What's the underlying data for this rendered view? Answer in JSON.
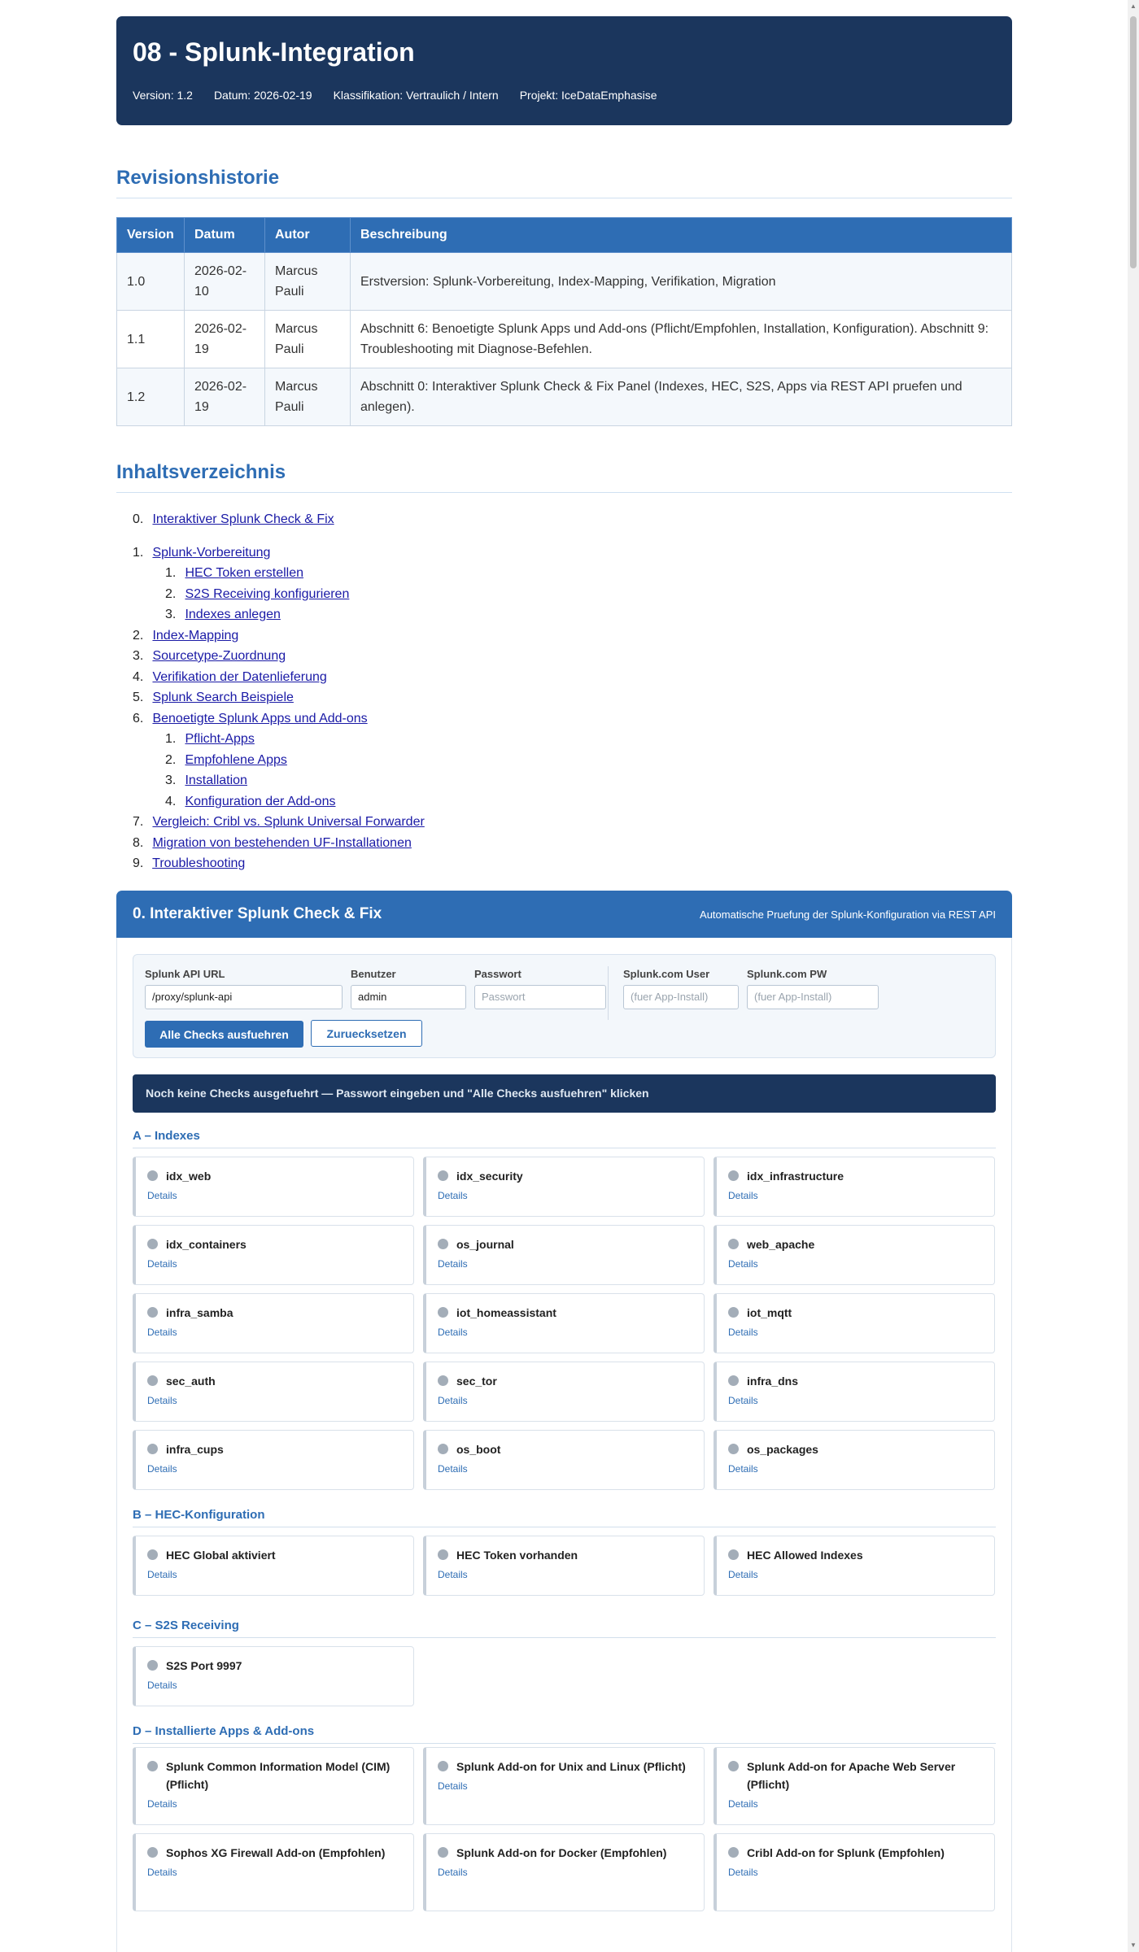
{
  "header": {
    "title": "08 - Splunk-Integration",
    "version": "Version: 1.2",
    "date": "Datum: 2026-02-19",
    "classification": "Klassifikation: Vertraulich / Intern",
    "project": "Projekt: IceDataEmphasise"
  },
  "revision": {
    "title": "Revisionshistorie",
    "columns": [
      "Version",
      "Datum",
      "Autor",
      "Beschreibung"
    ],
    "rows": [
      [
        "1.0",
        "2026-02-10",
        "Marcus Pauli",
        "Erstversion: Splunk-Vorbereitung, Index-Mapping, Verifikation, Migration"
      ],
      [
        "1.1",
        "2026-02-19",
        "Marcus Pauli",
        "Abschnitt 6: Benoetigte Splunk Apps und Add-ons (Pflicht/Empfohlen, Installation, Konfiguration). Abschnitt 9: Troubleshooting mit Diagnose-Befehlen."
      ],
      [
        "1.2",
        "2026-02-19",
        "Marcus Pauli",
        "Abschnitt 0: Interaktiver Splunk Check & Fix Panel (Indexes, HEC, S2S, Apps via REST API pruefen und anlegen)."
      ]
    ]
  },
  "toc": {
    "title": "Inhaltsverzeichnis",
    "items": [
      {
        "num": "0.",
        "label": "Interaktiver Splunk Check & Fix"
      },
      {
        "num": "1.",
        "label": "Splunk-Vorbereitung",
        "sub": [
          "HEC Token erstellen",
          "S2S Receiving konfigurieren",
          "Indexes anlegen"
        ]
      },
      {
        "num": "2.",
        "label": "Index-Mapping"
      },
      {
        "num": "3.",
        "label": "Sourcetype-Zuordnung"
      },
      {
        "num": "4.",
        "label": "Verifikation der Datenlieferung"
      },
      {
        "num": "5.",
        "label": "Splunk Search Beispiele"
      },
      {
        "num": "6.",
        "label": "Benoetigte Splunk Apps und Add-ons",
        "sub": [
          "Pflicht-Apps",
          "Empfohlene Apps",
          "Installation",
          "Konfiguration der Add-ons"
        ]
      },
      {
        "num": "7.",
        "label": "Vergleich: Cribl vs. Splunk Universal Forwarder"
      },
      {
        "num": "8.",
        "label": "Migration von bestehenden UF-Installationen"
      },
      {
        "num": "9.",
        "label": "Troubleshooting"
      }
    ]
  },
  "panel": {
    "title": "0. Interaktiver Splunk Check & Fix",
    "subtitle": "Automatische Pruefung der Splunk-Konfiguration via REST API",
    "form": {
      "api_url_label": "Splunk API URL",
      "api_url_value": "/proxy/splunk-api",
      "user_label": "Benutzer",
      "user_value": "admin",
      "password_label": "Passwort",
      "password_placeholder": "Passwort",
      "com_user_label": "Splunk.com User",
      "com_user_placeholder": "(fuer App-Install)",
      "com_pw_label": "Splunk.com PW",
      "com_pw_placeholder": "(fuer App-Install)",
      "run_button": "Alle Checks ausfuehren",
      "reset_button": "Zuruecksetzen"
    },
    "status": "Noch keine Checks ausgefuehrt — Passwort eingeben und \"Alle Checks ausfuehren\" klicken",
    "details_label": "Details",
    "categories": [
      {
        "title": "A – Indexes",
        "items": [
          "idx_web",
          "idx_security",
          "idx_infrastructure",
          "idx_containers",
          "os_journal",
          "web_apache",
          "infra_samba",
          "iot_homeassistant",
          "iot_mqtt",
          "sec_auth",
          "sec_tor",
          "infra_dns",
          "infra_cups",
          "os_boot",
          "os_packages"
        ]
      },
      {
        "title": "B – HEC-Konfiguration",
        "items": [
          "HEC Global aktiviert",
          "HEC Token vorhanden",
          "HEC Allowed Indexes"
        ]
      },
      {
        "title": "C – S2S Receiving",
        "items": [
          "S2S Port 9997"
        ]
      },
      {
        "title": "D – Installierte Apps & Add-ons",
        "items": [
          "Splunk Common Information Model (CIM) (Pflicht)",
          "Splunk Add-on for Unix and Linux (Pflicht)",
          "Splunk Add-on for Apache Web Server (Pflicht)",
          "Sophos XG Firewall Add-on (Empfohlen)",
          "Splunk Add-on for Docker (Empfohlen)",
          "Cribl Add-on for Splunk (Empfohlen)"
        ]
      }
    ]
  }
}
